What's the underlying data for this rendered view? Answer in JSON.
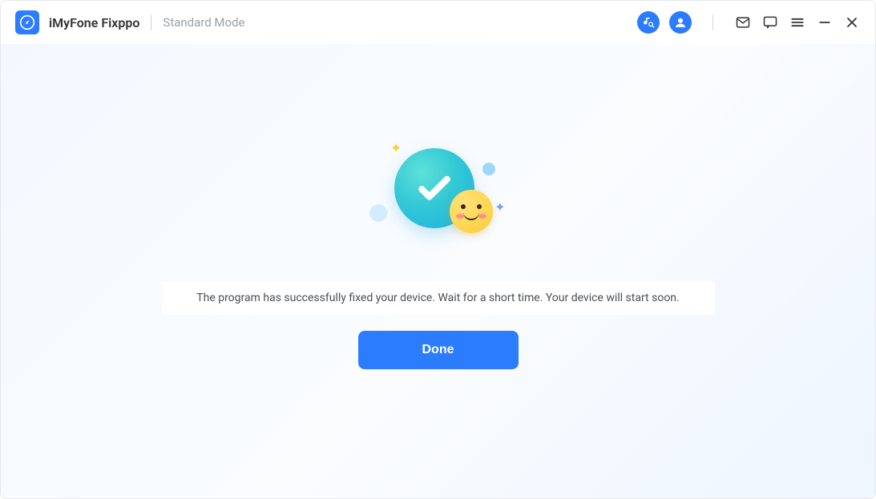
{
  "titlebar": {
    "app_name": "iMyFone Fixppo",
    "mode": "Standard Mode"
  },
  "icons": {
    "music_search": "music-search-icon",
    "account": "account-icon",
    "mail": "mail-icon",
    "feedback": "feedback-icon",
    "menu": "menu-icon",
    "minimize": "minimize-icon",
    "close": "close-icon"
  },
  "main": {
    "success_message": "The program has successfully fixed your device. Wait for a short time. Your device will start soon.",
    "done_label": "Done"
  },
  "colors": {
    "primary": "#2b7cff",
    "teal": "#2fc3d6"
  }
}
